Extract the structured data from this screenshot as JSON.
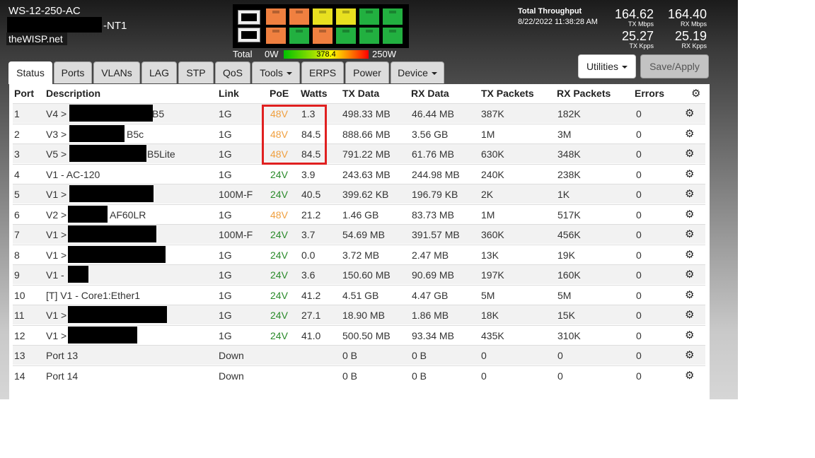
{
  "device": {
    "name": "WS-12-250-AC",
    "name_suffix": "-NT1",
    "site": "theWISP.net"
  },
  "power": {
    "total_label": "Total",
    "min": "0W",
    "current": "378.4",
    "max": "250W"
  },
  "port_panel": {
    "port_colors": [
      "#f08040",
      "#f08040",
      "#e8e020",
      "#e8e020",
      "#22b040",
      "#22b040",
      "#f08040",
      "#22b040",
      "#f08040",
      "#22b040",
      "#22b040",
      "#22b040"
    ]
  },
  "throughput": {
    "label": "Total Throughput",
    "timestamp": "8/22/2022 11:38:28 AM",
    "tx_mbps": "164.62",
    "tx_mbps_unit": "TX Mbps",
    "rx_mbps": "164.40",
    "rx_mbps_unit": "RX Mbps",
    "tx_kpps": "25.27",
    "tx_kpps_unit": "TX Kpps",
    "rx_kpps": "25.19",
    "rx_kpps_unit": "RX Kpps"
  },
  "tabs": [
    "Status",
    "Ports",
    "VLANs",
    "LAG",
    "STP",
    "QoS",
    "Tools",
    "ERPS",
    "Power",
    "Device"
  ],
  "buttons": {
    "utilities": "Utilities",
    "save": "Save/Apply"
  },
  "table": {
    "headers": [
      "Port",
      "Description",
      "Link",
      "PoE",
      "Watts",
      "TX Data",
      "RX Data",
      "TX Packets",
      "RX Packets",
      "Errors"
    ],
    "rows": [
      {
        "port": "1",
        "desc_prefix": "V4 >",
        "desc_suffix": "B5",
        "link": "1G",
        "poe": "48V",
        "watts": "1.3",
        "tx": "498.33 MB",
        "rx": "46.44 MB",
        "txp": "387K",
        "rxp": "182K",
        "err": "0"
      },
      {
        "port": "2",
        "desc_prefix": "V3 >",
        "desc_suffix": "B5c",
        "link": "1G",
        "poe": "48V",
        "watts": "84.5",
        "tx": "888.66 MB",
        "rx": "3.56 GB",
        "txp": "1M",
        "rxp": "3M",
        "err": "0"
      },
      {
        "port": "3",
        "desc_prefix": "V5 >",
        "desc_suffix": "B5Lite",
        "link": "1G",
        "poe": "48V",
        "watts": "84.5",
        "tx": "791.22 MB",
        "rx": "61.76 MB",
        "txp": "630K",
        "rxp": "348K",
        "err": "0"
      },
      {
        "port": "4",
        "desc_prefix": "V1 - AC-120",
        "desc_suffix": "",
        "link": "1G",
        "poe": "24V",
        "watts": "3.9",
        "tx": "243.63 MB",
        "rx": "244.98 MB",
        "txp": "240K",
        "rxp": "238K",
        "err": "0"
      },
      {
        "port": "5",
        "desc_prefix": "V1 >",
        "desc_suffix": "",
        "link": "100M-F",
        "poe": "24V",
        "watts": "40.5",
        "tx": "399.62 KB",
        "rx": "196.79 KB",
        "txp": "2K",
        "rxp": "1K",
        "err": "0"
      },
      {
        "port": "6",
        "desc_prefix": "V2 >",
        "desc_suffix": "AF60LR",
        "link": "1G",
        "poe": "48V",
        "watts": "21.2",
        "tx": "1.46 GB",
        "rx": "83.73 MB",
        "txp": "1M",
        "rxp": "517K",
        "err": "0"
      },
      {
        "port": "7",
        "desc_prefix": "V1 >",
        "desc_suffix": "",
        "link": "100M-F",
        "poe": "24V",
        "watts": "3.7",
        "tx": "54.69 MB",
        "rx": "391.57 MB",
        "txp": "360K",
        "rxp": "456K",
        "err": "0"
      },
      {
        "port": "8",
        "desc_prefix": "V1 >",
        "desc_suffix": "",
        "link": "1G",
        "poe": "24V",
        "watts": "0.0",
        "tx": "3.72 MB",
        "rx": "2.47 MB",
        "txp": "13K",
        "rxp": "19K",
        "err": "0"
      },
      {
        "port": "9",
        "desc_prefix": "V1 -",
        "desc_suffix": "",
        "link": "1G",
        "poe": "24V",
        "watts": "3.6",
        "tx": "150.60 MB",
        "rx": "90.69 MB",
        "txp": "197K",
        "rxp": "160K",
        "err": "0"
      },
      {
        "port": "10",
        "desc_prefix": "[T] V1 - Core1:Ether1",
        "desc_suffix": "",
        "link": "1G",
        "poe": "24V",
        "watts": "41.2",
        "tx": "4.51 GB",
        "rx": "4.47 GB",
        "txp": "5M",
        "rxp": "5M",
        "err": "0"
      },
      {
        "port": "11",
        "desc_prefix": "V1 >",
        "desc_suffix": "",
        "link": "1G",
        "poe": "24V",
        "watts": "27.1",
        "tx": "18.90 MB",
        "rx": "1.86 MB",
        "txp": "18K",
        "rxp": "15K",
        "err": "0"
      },
      {
        "port": "12",
        "desc_prefix": "V1 >",
        "desc_suffix": "",
        "link": "1G",
        "poe": "24V",
        "watts": "41.0",
        "tx": "500.50 MB",
        "rx": "93.34 MB",
        "txp": "435K",
        "rxp": "310K",
        "err": "0"
      },
      {
        "port": "13",
        "desc_prefix": "Port 13",
        "desc_suffix": "",
        "link": "Down",
        "poe": "",
        "watts": "",
        "tx": "0 B",
        "rx": "0 B",
        "txp": "0",
        "rxp": "0",
        "err": "0"
      },
      {
        "port": "14",
        "desc_prefix": "Port 14",
        "desc_suffix": "",
        "link": "Down",
        "poe": "",
        "watts": "",
        "tx": "0 B",
        "rx": "0 B",
        "txp": "0",
        "rxp": "0",
        "err": "0"
      }
    ]
  },
  "icons": {
    "settings": "gear-icon"
  }
}
